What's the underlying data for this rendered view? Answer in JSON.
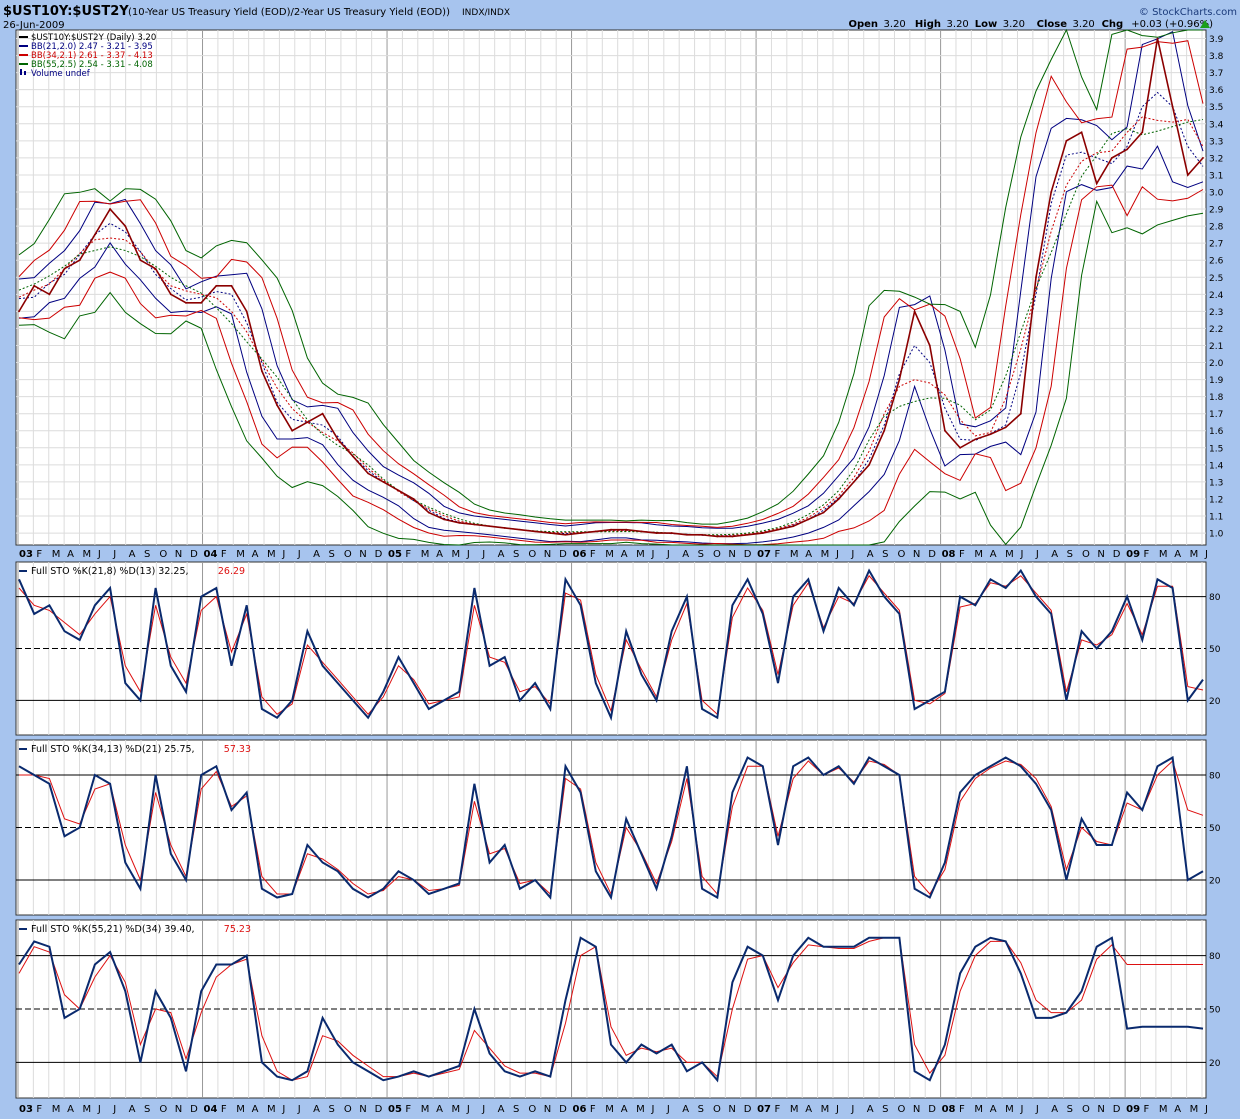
{
  "header": {
    "symbol": "$UST10Y:$UST2Y",
    "description": "(10-Year US Treasury Yield (EOD)/2-Year US Treasury Yield (EOD))",
    "exchange": "INDX/INDX",
    "date": "26-Jun-2009",
    "copyright": "© StockCharts.com",
    "ohlc": [
      {
        "label": "Open",
        "value": "3.20"
      },
      {
        "label": "High",
        "value": "3.20"
      },
      {
        "label": "Low",
        "value": "3.20"
      },
      {
        "label": "Close",
        "value": "3.20"
      },
      {
        "label": "Chg",
        "value": "+0.03 (+0.96%)"
      }
    ]
  },
  "legend": [
    {
      "text": "$UST10Y:$UST2Y (Daily) 3.20",
      "color": "#000000"
    },
    {
      "text": "BB(21,2.0) 2.47 - 3.21 - 3.95",
      "color": "#000080"
    },
    {
      "text": "BB(34,2.1) 2.61 - 3.37 - 4.13",
      "color": "#cc0000"
    },
    {
      "text": "BB(55,2.5) 2.54 - 3.31 - 4.08",
      "color": "#006400"
    },
    {
      "text": "Volume undef",
      "color": "#000080"
    }
  ],
  "colors": {
    "background": "#a7c4ee",
    "panel": "#ffffff",
    "price": "#8b0000",
    "bb21": "#000080",
    "bb34": "#cc0000",
    "bb55": "#006400",
    "stoK": "#0a2a6e",
    "stoD": "#dd1111",
    "grid": "#dcdcdc"
  },
  "time_axis": [
    {
      "label": "03",
      "bold": true
    },
    {
      "label": "F"
    },
    {
      "label": "M"
    },
    {
      "label": "A"
    },
    {
      "label": "M"
    },
    {
      "label": "J"
    },
    {
      "label": "J"
    },
    {
      "label": "A"
    },
    {
      "label": "S"
    },
    {
      "label": "O"
    },
    {
      "label": "N"
    },
    {
      "label": "D"
    },
    {
      "label": "04",
      "bold": true
    },
    {
      "label": "F"
    },
    {
      "label": "M"
    },
    {
      "label": "A"
    },
    {
      "label": "M"
    },
    {
      "label": "J"
    },
    {
      "label": "J"
    },
    {
      "label": "A"
    },
    {
      "label": "S"
    },
    {
      "label": "O"
    },
    {
      "label": "N"
    },
    {
      "label": "D"
    },
    {
      "label": "05",
      "bold": true
    },
    {
      "label": "F"
    },
    {
      "label": "M"
    },
    {
      "label": "A"
    },
    {
      "label": "M"
    },
    {
      "label": "J"
    },
    {
      "label": "J"
    },
    {
      "label": "A"
    },
    {
      "label": "S"
    },
    {
      "label": "O"
    },
    {
      "label": "N"
    },
    {
      "label": "D"
    },
    {
      "label": "06",
      "bold": true
    },
    {
      "label": "F"
    },
    {
      "label": "M"
    },
    {
      "label": "A"
    },
    {
      "label": "M"
    },
    {
      "label": "J"
    },
    {
      "label": "J"
    },
    {
      "label": "A"
    },
    {
      "label": "S"
    },
    {
      "label": "O"
    },
    {
      "label": "N"
    },
    {
      "label": "D"
    },
    {
      "label": "07",
      "bold": true
    },
    {
      "label": "F"
    },
    {
      "label": "M"
    },
    {
      "label": "A"
    },
    {
      "label": "M"
    },
    {
      "label": "J"
    },
    {
      "label": "J"
    },
    {
      "label": "A"
    },
    {
      "label": "S"
    },
    {
      "label": "O"
    },
    {
      "label": "N"
    },
    {
      "label": "D"
    },
    {
      "label": "08",
      "bold": true
    },
    {
      "label": "F"
    },
    {
      "label": "M"
    },
    {
      "label": "A"
    },
    {
      "label": "M"
    },
    {
      "label": "J"
    },
    {
      "label": "J"
    },
    {
      "label": "A"
    },
    {
      "label": "S"
    },
    {
      "label": "O"
    },
    {
      "label": "N"
    },
    {
      "label": "D"
    },
    {
      "label": "09",
      "bold": true
    },
    {
      "label": "F"
    },
    {
      "label": "M"
    },
    {
      "label": "A"
    },
    {
      "label": "M"
    },
    {
      "label": "J"
    }
  ],
  "chart_data": [
    {
      "type": "line",
      "title": "$UST10Y:$UST2Y",
      "ylabel": "",
      "ylim": [
        0.93,
        3.95
      ],
      "yticks": [
        1.0,
        1.1,
        1.2,
        1.3,
        1.4,
        1.5,
        1.6,
        1.7,
        1.8,
        1.9,
        2.0,
        2.1,
        2.2,
        2.3,
        2.4,
        2.5,
        2.6,
        2.7,
        2.8,
        2.9,
        3.0,
        3.1,
        3.2,
        3.3,
        3.4,
        3.5,
        3.6,
        3.7,
        3.8,
        3.9
      ],
      "x": [
        0,
        1,
        2,
        3,
        4,
        5,
        6,
        7,
        8,
        9,
        10,
        11,
        12,
        13,
        14,
        15,
        16,
        17,
        18,
        19,
        20,
        21,
        22,
        23,
        24,
        25,
        26,
        27,
        28,
        29,
        30,
        31,
        32,
        33,
        34,
        35,
        36,
        37,
        38,
        39,
        40,
        41,
        42,
        43,
        44,
        45,
        46,
        47,
        48,
        49,
        50,
        51,
        52,
        53,
        54,
        55,
        56,
        57,
        58,
        59,
        60,
        61,
        62,
        63,
        64,
        65,
        66,
        67,
        68,
        69,
        70,
        71,
        72,
        73,
        74,
        75,
        76,
        77,
        78
      ],
      "series": [
        {
          "name": "$UST10Y:$UST2Y (Daily) 3.20",
          "values": [
            2.3,
            2.45,
            2.4,
            2.55,
            2.6,
            2.75,
            2.9,
            2.8,
            2.6,
            2.55,
            2.4,
            2.35,
            2.35,
            2.45,
            2.45,
            2.3,
            1.95,
            1.75,
            1.6,
            1.65,
            1.7,
            1.55,
            1.45,
            1.35,
            1.3,
            1.25,
            1.2,
            1.12,
            1.08,
            1.06,
            1.05,
            1.04,
            1.03,
            1.02,
            1.01,
            1.0,
            0.99,
            1.0,
            1.01,
            1.02,
            1.02,
            1.01,
            1.0,
            1.0,
            0.99,
            0.99,
            0.98,
            0.98,
            0.99,
            1.0,
            1.02,
            1.04,
            1.08,
            1.12,
            1.2,
            1.3,
            1.4,
            1.6,
            1.9,
            2.3,
            2.1,
            1.6,
            1.5,
            1.55,
            1.58,
            1.62,
            1.7,
            2.5,
            3.0,
            3.3,
            3.35,
            3.05,
            3.2,
            3.25,
            3.35,
            3.9,
            3.5,
            3.1,
            3.2
          ]
        },
        {
          "name": "BB(21,2.0)",
          "values": []
        },
        {
          "name": "BB(34,2.1)",
          "values": []
        },
        {
          "name": "BB(55,2.5)",
          "values": []
        }
      ]
    },
    {
      "type": "line",
      "title": "Full STO %K(21,8) %D(13) 32.25, 26.29",
      "legend_k": "Full STO %K(21,8) %D(13) 32.25,",
      "legend_d": "26.29",
      "ylim": [
        0,
        100
      ],
      "yticks": [
        20,
        50,
        80
      ],
      "x": [
        0,
        1,
        2,
        3,
        4,
        5,
        6,
        7,
        8,
        9,
        10,
        11,
        12,
        13,
        14,
        15,
        16,
        17,
        18,
        19,
        20,
        21,
        22,
        23,
        24,
        25,
        26,
        27,
        28,
        29,
        30,
        31,
        32,
        33,
        34,
        35,
        36,
        37,
        38,
        39,
        40,
        41,
        42,
        43,
        44,
        45,
        46,
        47,
        48,
        49,
        50,
        51,
        52,
        53,
        54,
        55,
        56,
        57,
        58,
        59,
        60,
        61,
        62,
        63,
        64,
        65,
        66,
        67,
        68,
        69,
        70,
        71,
        72,
        73,
        74,
        75,
        76,
        77,
        78
      ],
      "series": [
        {
          "name": "%K",
          "values": [
            90,
            70,
            75,
            60,
            55,
            75,
            85,
            30,
            20,
            85,
            40,
            25,
            80,
            85,
            40,
            75,
            15,
            10,
            20,
            60,
            40,
            30,
            20,
            10,
            25,
            45,
            30,
            15,
            20,
            25,
            85,
            40,
            45,
            20,
            30,
            15,
            90,
            75,
            30,
            10,
            60,
            35,
            20,
            60,
            80,
            15,
            10,
            75,
            90,
            70,
            30,
            80,
            90,
            60,
            85,
            75,
            95,
            80,
            70,
            15,
            20,
            25,
            80,
            75,
            90,
            85,
            95,
            80,
            70,
            20,
            60,
            50,
            60,
            80,
            55,
            90,
            85,
            20,
            32
          ]
        },
        {
          "name": "%D",
          "values": [
            85,
            75,
            72,
            65,
            58,
            70,
            80,
            40,
            25,
            75,
            45,
            30,
            72,
            80,
            48,
            70,
            22,
            12,
            18,
            52,
            42,
            32,
            22,
            12,
            22,
            40,
            32,
            18,
            20,
            22,
            75,
            45,
            42,
            25,
            28,
            18,
            82,
            78,
            35,
            14,
            55,
            38,
            22,
            55,
            76,
            20,
            12,
            68,
            85,
            72,
            35,
            75,
            88,
            62,
            80,
            76,
            92,
            82,
            72,
            20,
            18,
            24,
            74,
            76,
            88,
            86,
            92,
            82,
            72,
            25,
            55,
            52,
            58,
            76,
            58,
            86,
            86,
            28,
            26
          ]
        }
      ]
    },
    {
      "type": "line",
      "title": "Full STO %K(34,13) %D(21) 25.75, 57.33",
      "legend_k": "Full STO %K(34,13) %D(21) 25.75,",
      "legend_d": "57.33",
      "ylim": [
        0,
        100
      ],
      "yticks": [
        20,
        50,
        80
      ],
      "x": [
        0,
        1,
        2,
        3,
        4,
        5,
        6,
        7,
        8,
        9,
        10,
        11,
        12,
        13,
        14,
        15,
        16,
        17,
        18,
        19,
        20,
        21,
        22,
        23,
        24,
        25,
        26,
        27,
        28,
        29,
        30,
        31,
        32,
        33,
        34,
        35,
        36,
        37,
        38,
        39,
        40,
        41,
        42,
        43,
        44,
        45,
        46,
        47,
        48,
        49,
        50,
        51,
        52,
        53,
        54,
        55,
        56,
        57,
        58,
        59,
        60,
        61,
        62,
        63,
        64,
        65,
        66,
        67,
        68,
        69,
        70,
        71,
        72,
        73,
        74,
        75,
        76,
        77,
        78
      ],
      "series": [
        {
          "name": "%K",
          "values": [
            85,
            80,
            75,
            45,
            50,
            80,
            75,
            30,
            15,
            80,
            35,
            20,
            80,
            85,
            60,
            70,
            15,
            10,
            12,
            40,
            30,
            25,
            15,
            10,
            15,
            25,
            20,
            12,
            15,
            18,
            75,
            30,
            40,
            15,
            20,
            10,
            85,
            70,
            25,
            10,
            55,
            35,
            15,
            45,
            85,
            15,
            10,
            70,
            90,
            85,
            40,
            85,
            90,
            80,
            85,
            75,
            90,
            85,
            80,
            15,
            10,
            30,
            70,
            80,
            85,
            90,
            85,
            75,
            60,
            20,
            55,
            40,
            40,
            70,
            60,
            85,
            90,
            20,
            25
          ]
        },
        {
          "name": "%D",
          "values": [
            80,
            80,
            78,
            55,
            52,
            72,
            75,
            40,
            20,
            70,
            40,
            22,
            72,
            82,
            62,
            68,
            22,
            12,
            12,
            35,
            32,
            26,
            18,
            12,
            14,
            22,
            20,
            14,
            15,
            17,
            65,
            35,
            38,
            18,
            20,
            12,
            78,
            72,
            30,
            12,
            50,
            36,
            18,
            42,
            78,
            22,
            12,
            62,
            85,
            85,
            45,
            78,
            88,
            80,
            84,
            76,
            88,
            86,
            80,
            22,
            12,
            26,
            65,
            78,
            84,
            88,
            86,
            78,
            62,
            26,
            50,
            42,
            40,
            64,
            60,
            80,
            88,
            60,
            57
          ]
        }
      ]
    },
    {
      "type": "line",
      "title": "Full STO %K(55,21) %D(34) 39.40, 75.23",
      "legend_k": "Full STO %K(55,21) %D(34) 39.40,",
      "legend_d": "75.23",
      "ylim": [
        0,
        100
      ],
      "yticks": [
        20,
        50,
        80
      ],
      "x": [
        0,
        1,
        2,
        3,
        4,
        5,
        6,
        7,
        8,
        9,
        10,
        11,
        12,
        13,
        14,
        15,
        16,
        17,
        18,
        19,
        20,
        21,
        22,
        23,
        24,
        25,
        26,
        27,
        28,
        29,
        30,
        31,
        32,
        33,
        34,
        35,
        36,
        37,
        38,
        39,
        40,
        41,
        42,
        43,
        44,
        45,
        46,
        47,
        48,
        49,
        50,
        51,
        52,
        53,
        54,
        55,
        56,
        57,
        58,
        59,
        60,
        61,
        62,
        63,
        64,
        65,
        66,
        67,
        68,
        69,
        70,
        71,
        72,
        73,
        74,
        75,
        76,
        77,
        78
      ],
      "series": [
        {
          "name": "%K",
          "values": [
            75,
            88,
            85,
            45,
            50,
            75,
            82,
            60,
            20,
            60,
            45,
            15,
            60,
            75,
            75,
            80,
            20,
            12,
            10,
            15,
            45,
            30,
            20,
            15,
            10,
            12,
            15,
            12,
            15,
            18,
            50,
            25,
            15,
            12,
            15,
            12,
            55,
            90,
            85,
            30,
            20,
            30,
            25,
            30,
            15,
            20,
            10,
            65,
            85,
            80,
            55,
            80,
            90,
            85,
            85,
            85,
            90,
            90,
            90,
            15,
            10,
            30,
            70,
            85,
            90,
            88,
            70,
            45,
            45,
            48,
            60,
            85,
            90,
            39,
            40,
            40,
            40,
            40,
            39
          ]
        },
        {
          "name": "%D",
          "values": [
            70,
            85,
            82,
            58,
            50,
            68,
            80,
            65,
            30,
            50,
            48,
            22,
            48,
            68,
            75,
            78,
            35,
            15,
            10,
            12,
            35,
            32,
            24,
            18,
            12,
            12,
            14,
            12,
            14,
            16,
            38,
            28,
            18,
            14,
            14,
            12,
            42,
            80,
            85,
            40,
            24,
            28,
            26,
            28,
            20,
            20,
            12,
            50,
            78,
            80,
            62,
            76,
            86,
            85,
            84,
            84,
            88,
            90,
            90,
            30,
            14,
            24,
            60,
            80,
            88,
            88,
            76,
            55,
            48,
            48,
            55,
            78,
            86,
            75,
            75,
            75,
            75,
            75,
            75
          ]
        }
      ]
    }
  ]
}
